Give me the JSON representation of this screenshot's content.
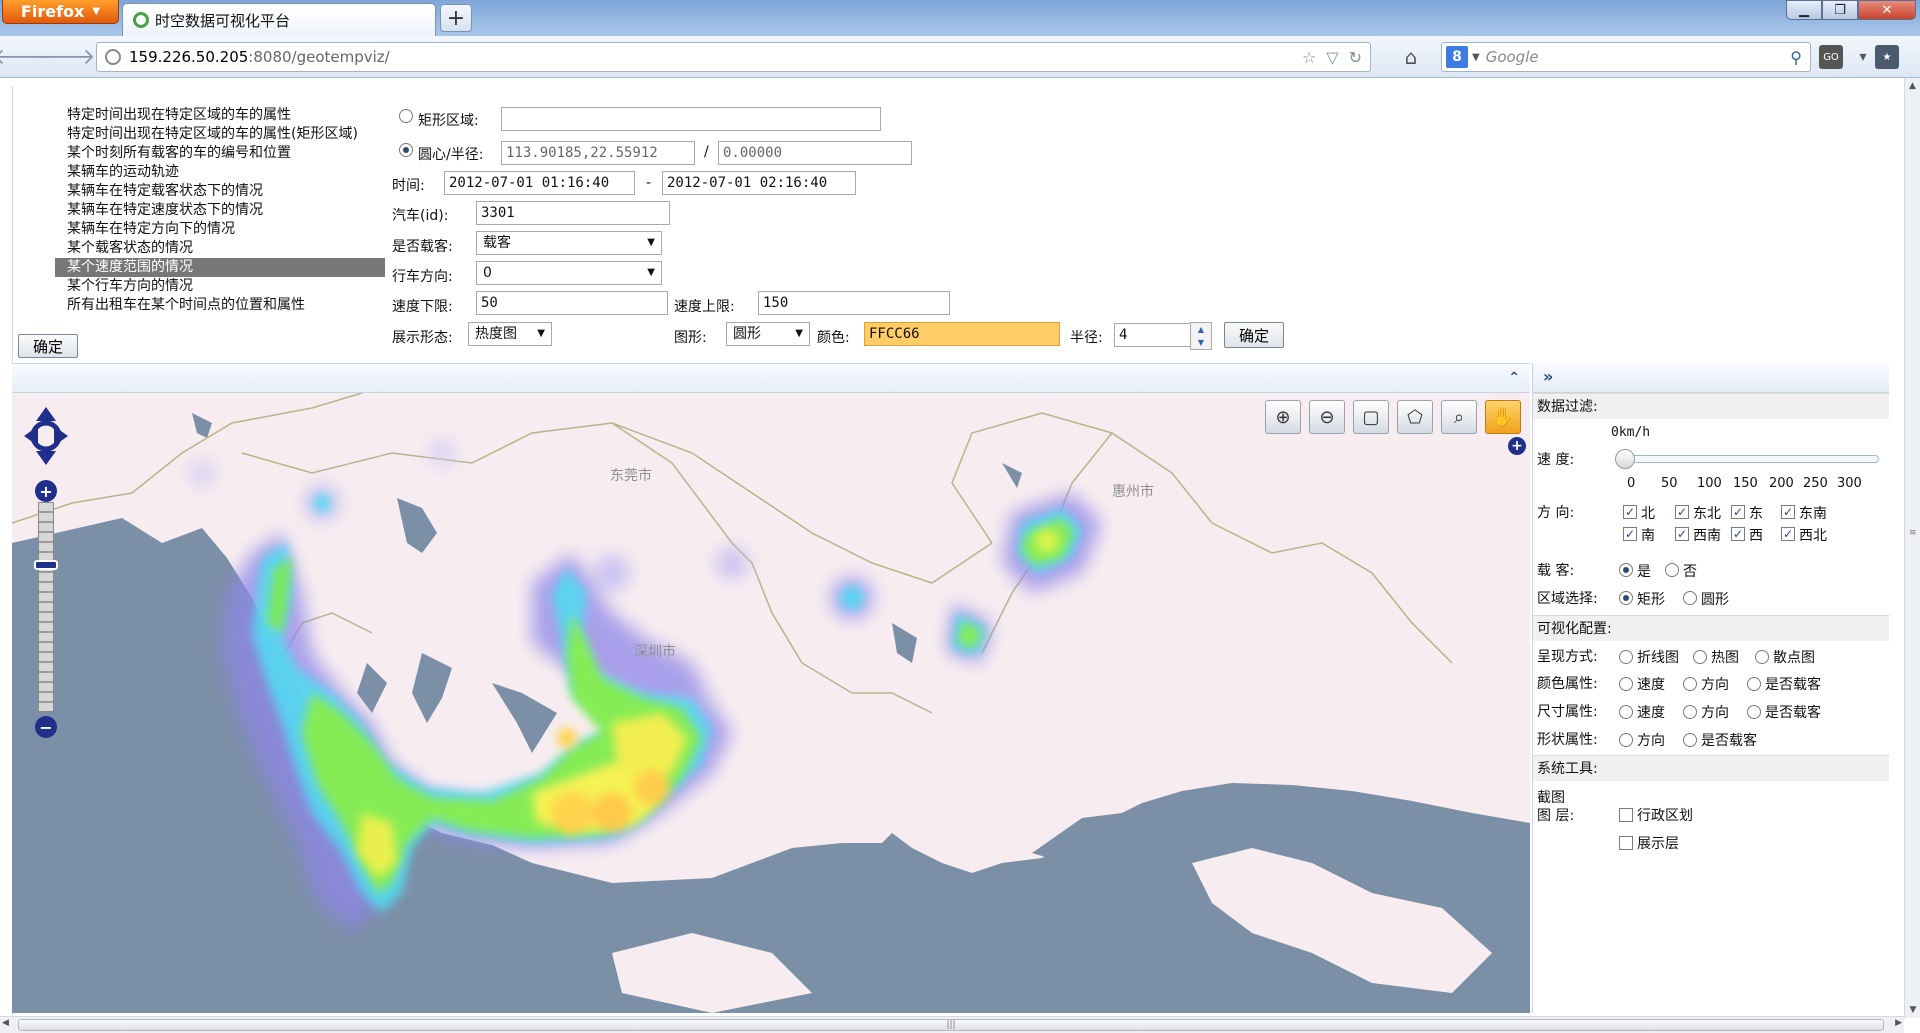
{
  "browser": {
    "menu_label": "Firefox",
    "tab_title": "时空数据可视化平台",
    "url_host": "159.226.50.205",
    "url_rest": ":8080/geotempviz/",
    "search_placeholder": "Google",
    "search_engine": "8"
  },
  "queries": {
    "items": [
      "特定时间出现在特定区域的车的属性",
      "特定时间出现在特定区域的车的属性(矩形区域)",
      "某个时刻所有载客的车的编号和位置",
      "某辆车的运动轨迹",
      "某辆车在特定载客状态下的情况",
      "某辆车在特定速度状态下的情况",
      "某辆车在特定方向下的情况",
      "某个载客状态的情况",
      "某个速度范围的情况",
      "某个行车方向的情况",
      "所有出租车在某个时间点的位置和属性"
    ],
    "selected_index": 8,
    "confirm_label": "确定"
  },
  "form": {
    "rect_label": "矩形区域:",
    "rect_value": "",
    "circle_label": "圆心/半径:",
    "center_value": "113.90185,22.55912",
    "slash": "/",
    "radius_value": "0.00000",
    "time_label": "时间:",
    "time_start": "2012-07-01 01:16:40",
    "time_sep": "-",
    "time_end": "2012-07-01 02:16:40",
    "car_label": "汽车(id):",
    "car_value": "3301",
    "carrying_label": "是否载客:",
    "carrying_value": "载客",
    "direction_label": "行车方向:",
    "direction_value": "0",
    "speed_min_label": "速度下限:",
    "speed_min_value": "50",
    "speed_max_label": "速度上限:",
    "speed_max_value": "150",
    "display_label": "展示形态:",
    "display_value": "热度图",
    "shape_label": "图形:",
    "shape_value": "圆形",
    "color_label": "颜色:",
    "color_value": "FFCC66",
    "color_hex": "#FFCC66",
    "radius_label": "半径:",
    "radius_num": "4",
    "confirm_label": "确定"
  },
  "map": {
    "cities": [
      "东莞市",
      "惠州市",
      "深圳市"
    ],
    "tools": [
      "zoom-in-tool",
      "zoom-out-tool",
      "rectangle-select-tool",
      "polygon-select-tool",
      "zoom-to-extent-tool",
      "pan-hand-tool"
    ],
    "active_tool": "pan-hand-tool"
  },
  "panel": {
    "data_filter": "数据过滤:",
    "speed_readout": "0km/h",
    "speed_label": "速     度:",
    "speed_value": 0,
    "speed_ticks": [
      "0",
      "50",
      "100",
      "150",
      "200",
      "250",
      "300"
    ],
    "direction_label": "方     向:",
    "directions": [
      "北",
      "东北",
      "东",
      "东南",
      "南",
      "西南",
      "西",
      "西北"
    ],
    "carry_label": "载     客:",
    "carry_yes": "是",
    "carry_no": "否",
    "region_label": "区域选择:",
    "region_rect": "矩形",
    "region_circle": "圆形",
    "viz_config": "可视化配置:",
    "render_label": "呈现方式:",
    "render_opts": [
      "折线图",
      "热图",
      "散点图"
    ],
    "color_attr_label": "颜色属性:",
    "color_attr_opts": [
      "速度",
      "方向",
      "是否载客"
    ],
    "size_attr_label": "尺寸属性:",
    "size_attr_opts": [
      "速度",
      "方向",
      "是否载客"
    ],
    "shape_attr_label": "形状属性:",
    "shape_attr_opts": [
      "方向",
      "是否载客"
    ],
    "system_tools": "系统工具:",
    "screenshot_label": "截图",
    "layer_label": "图     层:",
    "layer_opts": [
      "行政区划",
      "展示层"
    ]
  }
}
